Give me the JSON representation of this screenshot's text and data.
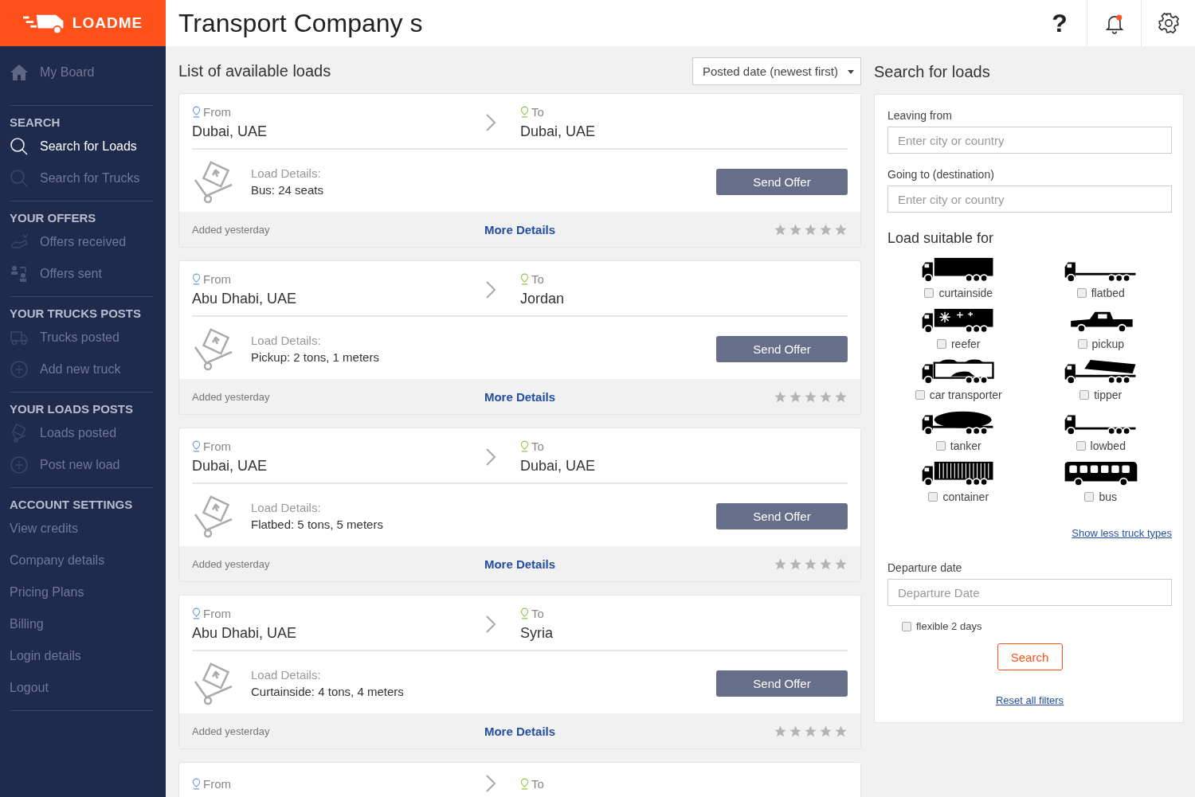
{
  "logo": {
    "text": "LOADME"
  },
  "header": {
    "title": "Transport Company s",
    "help": "?"
  },
  "sidebar": {
    "top": {
      "label": "My Board",
      "kind": "home",
      "selected": false
    },
    "sections": [
      {
        "title": "SEARCH",
        "items": [
          {
            "label": "Search for Loads",
            "kind": "search",
            "selected": true
          },
          {
            "label": "Search for Trucks",
            "kind": "search",
            "selected": false
          }
        ]
      },
      {
        "title": "YOUR OFFERS",
        "items": [
          {
            "label": "Offers received",
            "kind": "hand",
            "selected": false
          },
          {
            "label": "Offers sent",
            "kind": "people",
            "selected": false
          }
        ]
      },
      {
        "title": "YOUR TRUCKS POSTS",
        "items": [
          {
            "label": "Trucks posted",
            "kind": "truck",
            "selected": false
          },
          {
            "label": "Add new truck",
            "kind": "plus",
            "selected": false
          }
        ]
      },
      {
        "title": "YOUR LOADS POSTS",
        "items": [
          {
            "label": "Loads posted",
            "kind": "load",
            "selected": false
          },
          {
            "label": "Post new load",
            "kind": "plus",
            "selected": false
          }
        ]
      },
      {
        "title": "ACCOUNT SETTINGS",
        "items": [
          {
            "label": "View credits",
            "kind": "text",
            "selected": false
          },
          {
            "label": "Company details",
            "kind": "text",
            "selected": false
          },
          {
            "label": "Pricing Plans",
            "kind": "text",
            "selected": false
          },
          {
            "label": "Billing",
            "kind": "text",
            "selected": false
          },
          {
            "label": "Login details",
            "kind": "text",
            "selected": false
          },
          {
            "label": "Logout",
            "kind": "text",
            "selected": false
          }
        ]
      }
    ]
  },
  "list": {
    "title": "List of available loads",
    "sort": "Posted date (newest first)"
  },
  "loads": [
    {
      "from_label": "From",
      "from": "Dubai, UAE",
      "to_label": "To",
      "to": "Dubai, UAE",
      "details_label": "Load Details:",
      "details": "Bus: 24 seats",
      "offer": "Send Offer",
      "added": "Added yesterday",
      "more": "More Details",
      "stars": 0
    },
    {
      "from_label": "From",
      "from": "Abu Dhabi, UAE",
      "to_label": "To",
      "to": "Jordan",
      "details_label": "Load Details:",
      "details": "Pickup: 2 tons, 1 meters",
      "offer": "Send Offer",
      "added": "Added yesterday",
      "more": "More Details",
      "stars": 0
    },
    {
      "from_label": "From",
      "from": "Dubai, UAE",
      "to_label": "To",
      "to": "Dubai, UAE",
      "details_label": "Load Details:",
      "details": "Flatbed: 5 tons, 5 meters",
      "offer": "Send Offer",
      "added": "Added yesterday",
      "more": "More Details",
      "stars": 0
    },
    {
      "from_label": "From",
      "from": "Abu Dhabi, UAE",
      "to_label": "To",
      "to": "Syria",
      "details_label": "Load Details:",
      "details": "Curtainside: 4 tons, 4 meters",
      "offer": "Send Offer",
      "added": "Added yesterday",
      "more": "More Details",
      "stars": 0
    },
    {
      "from_label": "From",
      "to_label": "To"
    }
  ],
  "search": {
    "title": "Search for loads",
    "leaving": {
      "label": "Leaving from",
      "placeholder": "Enter city or country"
    },
    "going": {
      "label": "Going to (destination)",
      "placeholder": "Enter city or country"
    },
    "suitable_title": "Load suitable for",
    "truck_types": [
      {
        "kind": "curtainside",
        "label": "curtainside",
        "checked": false
      },
      {
        "kind": "flatbed",
        "label": "flatbed",
        "checked": false
      },
      {
        "kind": "reefer",
        "label": "reefer",
        "checked": false
      },
      {
        "kind": "pickup",
        "label": "pickup",
        "checked": false
      },
      {
        "kind": "car",
        "label": "car transporter",
        "checked": false
      },
      {
        "kind": "tipper",
        "label": "tipper",
        "checked": false
      },
      {
        "kind": "tanker",
        "label": "tanker",
        "checked": false
      },
      {
        "kind": "lowbed",
        "label": "lowbed",
        "checked": false
      },
      {
        "kind": "container",
        "label": "container",
        "checked": false
      },
      {
        "kind": "bus",
        "label": "bus",
        "checked": false
      }
    ],
    "show_less": "Show less truck types",
    "departure": {
      "label": "Departure date",
      "placeholder": "Departure Date"
    },
    "flexible": {
      "label": "flexible 2 days",
      "checked": false
    },
    "button": "Search",
    "reset": "Reset all filters"
  }
}
